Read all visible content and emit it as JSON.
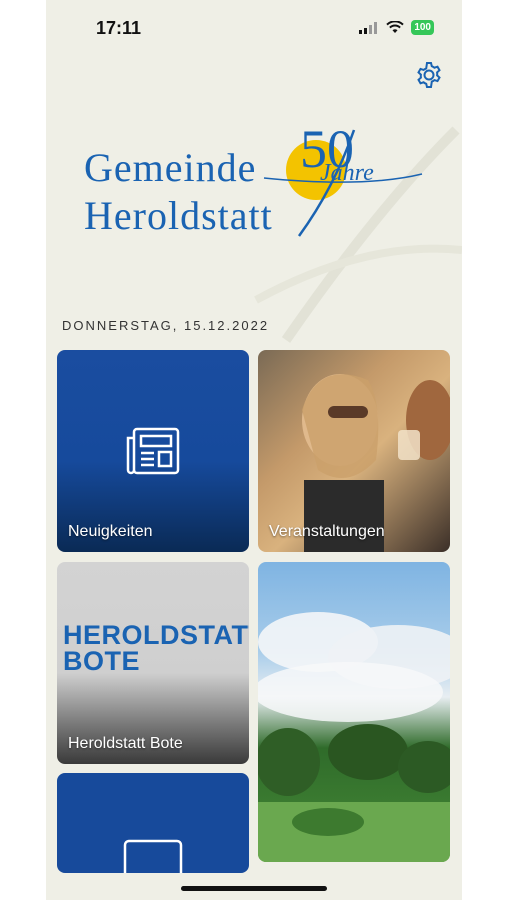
{
  "status_bar": {
    "time": "17:11",
    "battery": "100"
  },
  "header": {
    "settings_icon": "gear-icon"
  },
  "logo": {
    "line1": "Gemeinde",
    "line2": "Heroldstatt",
    "anniversary_number": "50",
    "anniversary_word": "Jahre"
  },
  "date": "DONNERSTAG, 15.12.2022",
  "tiles": [
    {
      "label": "Neuigkeiten",
      "icon": "newspaper-icon",
      "color": "#174a9b"
    },
    {
      "label": "Veranstaltungen",
      "icon": "photo-people"
    },
    {
      "label": "Heroldstatt Bote",
      "logo_line1": "Heroldstatt",
      "logo_line2": "Bote"
    },
    {
      "label": "",
      "icon": "photo-landscape"
    },
    {
      "label": "",
      "icon": "frame-icon",
      "color": "#174a9b"
    }
  ],
  "colors": {
    "accent": "#1a63b2",
    "tile_blue": "#174a9b",
    "background": "#efefe6"
  }
}
